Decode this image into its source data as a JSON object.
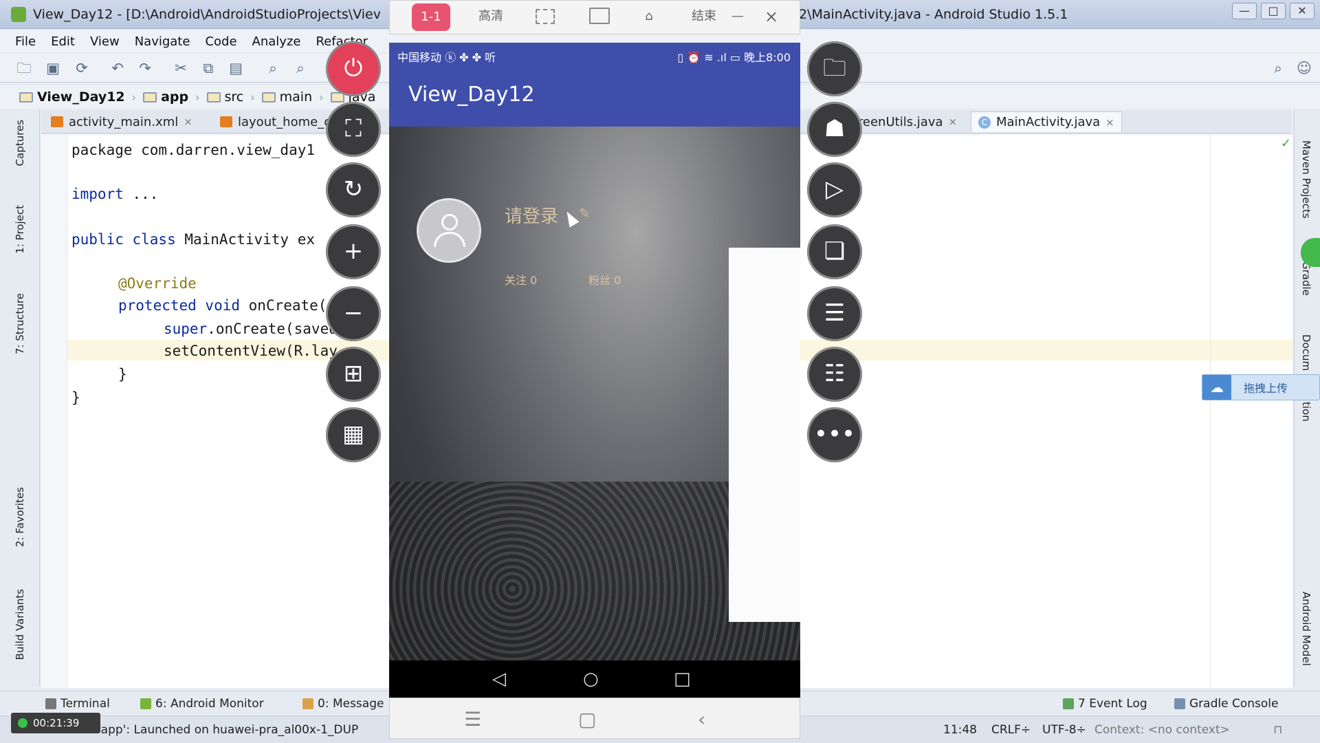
{
  "window": {
    "title_left": "View_Day12 - [D:\\Android\\AndroidStudioProjects\\Viev",
    "title_right": "2\\MainActivity.java - Android Studio 1.5.1",
    "min": "—",
    "max": "□",
    "close": "✕"
  },
  "menu": [
    "File",
    "Edit",
    "View",
    "Navigate",
    "Code",
    "Analyze",
    "Refactor"
  ],
  "breadcrumb": [
    "View_Day12",
    "app",
    "src",
    "main",
    "java"
  ],
  "tabs": {
    "t1": "activity_main.xml",
    "t2": "layout_home_cc",
    "t3": "creenUtils.java",
    "t4": "MainActivity.java",
    "close": "×"
  },
  "left_tools": [
    "Captures",
    "1: Project",
    "7: Structure",
    "2: Favorites",
    "Build Variants"
  ],
  "right_tools": [
    "Maven Projects",
    "Gradle",
    "Docum",
    "tion",
    "Android Model"
  ],
  "code": {
    "l1": "package com.darren.view_day1",
    "l2_kw": "import",
    "l2_rest": " ...",
    "l3_kw": "public class",
    "l3_rest": " MainActivity ex",
    "l4": "@Override",
    "l5_kw": "protected void",
    "l5_rest": " onCreate(",
    "l6_kw": "super",
    "l6_rest": ".onCreate(saved",
    "l7": "setContentView(R.lay",
    "l8": "}",
    "l9": "}"
  },
  "bottom_tools": {
    "terminal": "Terminal",
    "monitor": "6: Android Monitor",
    "messages": "0: Message",
    "eventlog": "7 Event Log",
    "gradle": "Gradle Console"
  },
  "status": {
    "message": "'app': Launched on huawei-pra_al00x-1_DUP",
    "time_rec": "00:21:39",
    "pos": "11:48",
    "crlf": "CRLF÷",
    "enc": "UTF-8÷",
    "context": "Context: <no context>"
  },
  "mirror": {
    "pill": "1-1",
    "hd": "高清",
    "end": "结束",
    "close": "×",
    "min": "—"
  },
  "phone": {
    "status_left": "中国移动 ⓚ ✤ ✤ 听",
    "status_right": "▯ ⏰ ≋ .ıl ▭ 晚上8:00",
    "app_title": "View_Day12",
    "login": "请登录",
    "follow": "关注 0",
    "fans": "粉丝 0"
  },
  "upload_label": "拖拽上传",
  "colors": {
    "phone_primary": "#3f4eaa",
    "power_button": "#e3405a"
  }
}
